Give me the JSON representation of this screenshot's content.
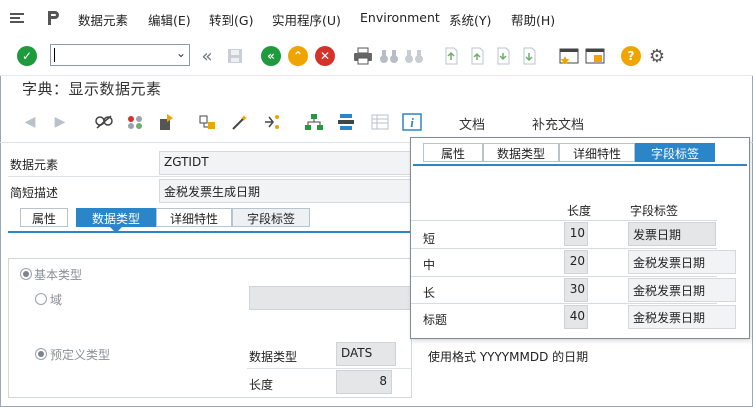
{
  "menu": {
    "items": [
      "数据元素(D)",
      "编辑(E)",
      "转到(G)",
      "实用程序(U)",
      "Environment",
      "系统(Y)",
      "帮助(H)"
    ],
    "labels": {
      "data_element": "数据元素",
      "edit": "编辑(E)",
      "goto": "转到(G)",
      "utilities": "实用程序(U)",
      "environment": "Environment",
      "system": "系统(Y)",
      "help": "帮助(H)"
    }
  },
  "toolbar": {
    "command_value": ""
  },
  "screen_title": "字典：显示数据元素",
  "app_toolbar": {
    "documentation": "文档",
    "supplementary_doc": "补充文档"
  },
  "form": {
    "data_element_label": "数据元素",
    "data_element_value": "ZGTIDT",
    "short_desc_label": "简短描述",
    "short_desc_value": "金税发票生成日期"
  },
  "tabs": {
    "attributes": "属性",
    "data_type": "数据类型",
    "further_chars": "详细特性",
    "field_label": "字段标签"
  },
  "data_type_panel": {
    "elementary_type": "基本类型",
    "domain": "域",
    "predefined_type": "预定义类型",
    "data_type_label": "数据类型",
    "data_type_value": "DATS",
    "data_type_desc": "使用格式 YYYYMMDD 的日期",
    "length_label": "长度",
    "length_value": "8"
  },
  "popup": {
    "tabs": [
      "属性",
      "数据类型",
      "详细特性",
      "字段标签"
    ],
    "col_length": "长度",
    "col_label": "字段标签",
    "rows": [
      {
        "name": "短",
        "length": "10",
        "label": "发票日期"
      },
      {
        "name": "中",
        "length": "20",
        "label": "金税发票日期"
      },
      {
        "name": "长",
        "length": "30",
        "label": "金税发票日期"
      },
      {
        "name": "标题",
        "length": "40",
        "label": "金税发票日期"
      }
    ]
  },
  "colors": {
    "accent": "#2a85c9",
    "ok_green": "#1f9a3c",
    "cancel_red": "#d6322c",
    "exit_orange": "#f0a400"
  }
}
